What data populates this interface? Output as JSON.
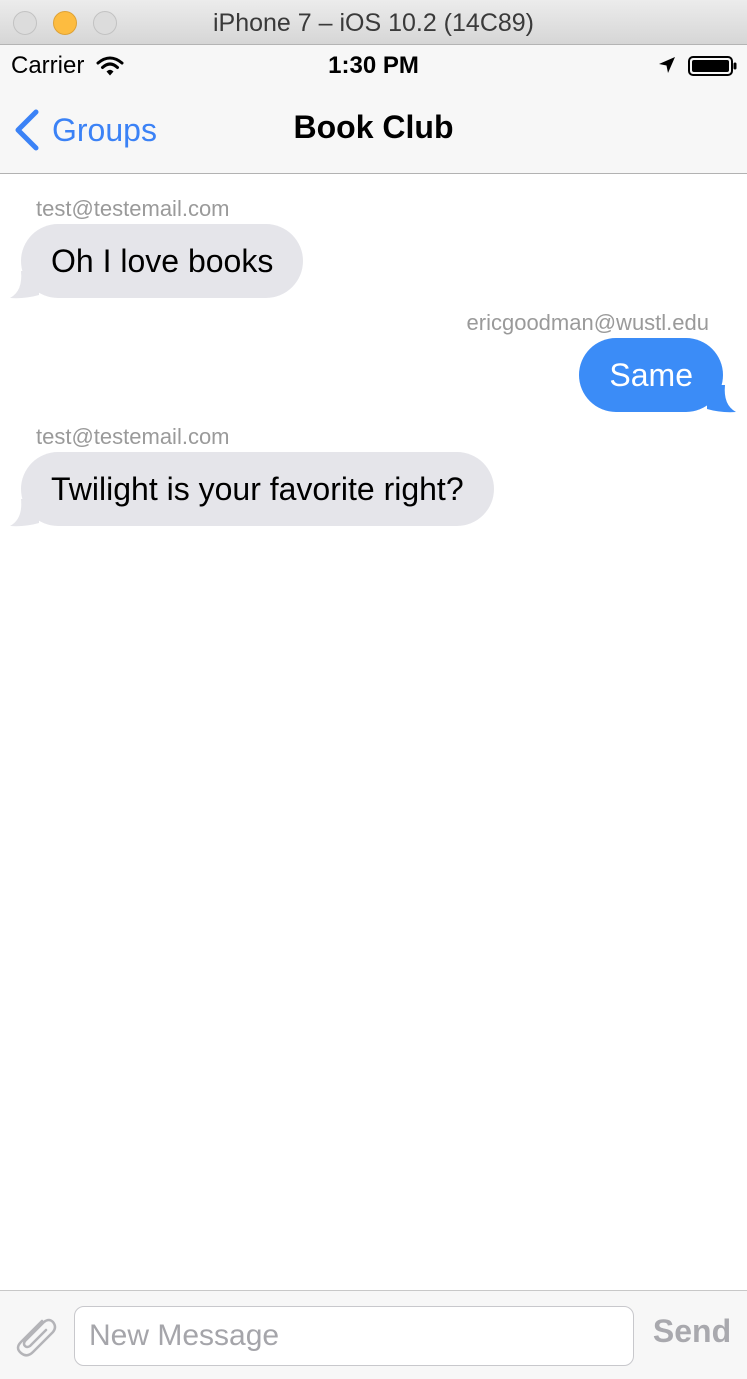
{
  "window": {
    "title": "iPhone 7 – iOS 10.2 (14C89)"
  },
  "status_bar": {
    "carrier": "Carrier",
    "time": "1:30 PM",
    "icons": [
      "wifi-icon",
      "location-icon",
      "battery-icon"
    ]
  },
  "nav_bar": {
    "back_label": "Groups",
    "title": "Book Club"
  },
  "messages": [
    {
      "sender": "test@testemail.com",
      "text": "Oh I love books",
      "direction": "incoming"
    },
    {
      "sender": "ericgoodman@wustl.edu",
      "text": "Same",
      "direction": "outgoing"
    },
    {
      "sender": "test@testemail.com",
      "text": "Twilight is your favorite right?",
      "direction": "incoming"
    }
  ],
  "input_bar": {
    "placeholder": "New Message",
    "value": "",
    "send_label": "Send"
  },
  "colors": {
    "accent": "#3b82f6",
    "outgoing_bubble": "#3b8cf7",
    "incoming_bubble": "#e5e5ea",
    "sender_text": "#9a9a9a",
    "send_disabled": "#a9a9ae"
  }
}
